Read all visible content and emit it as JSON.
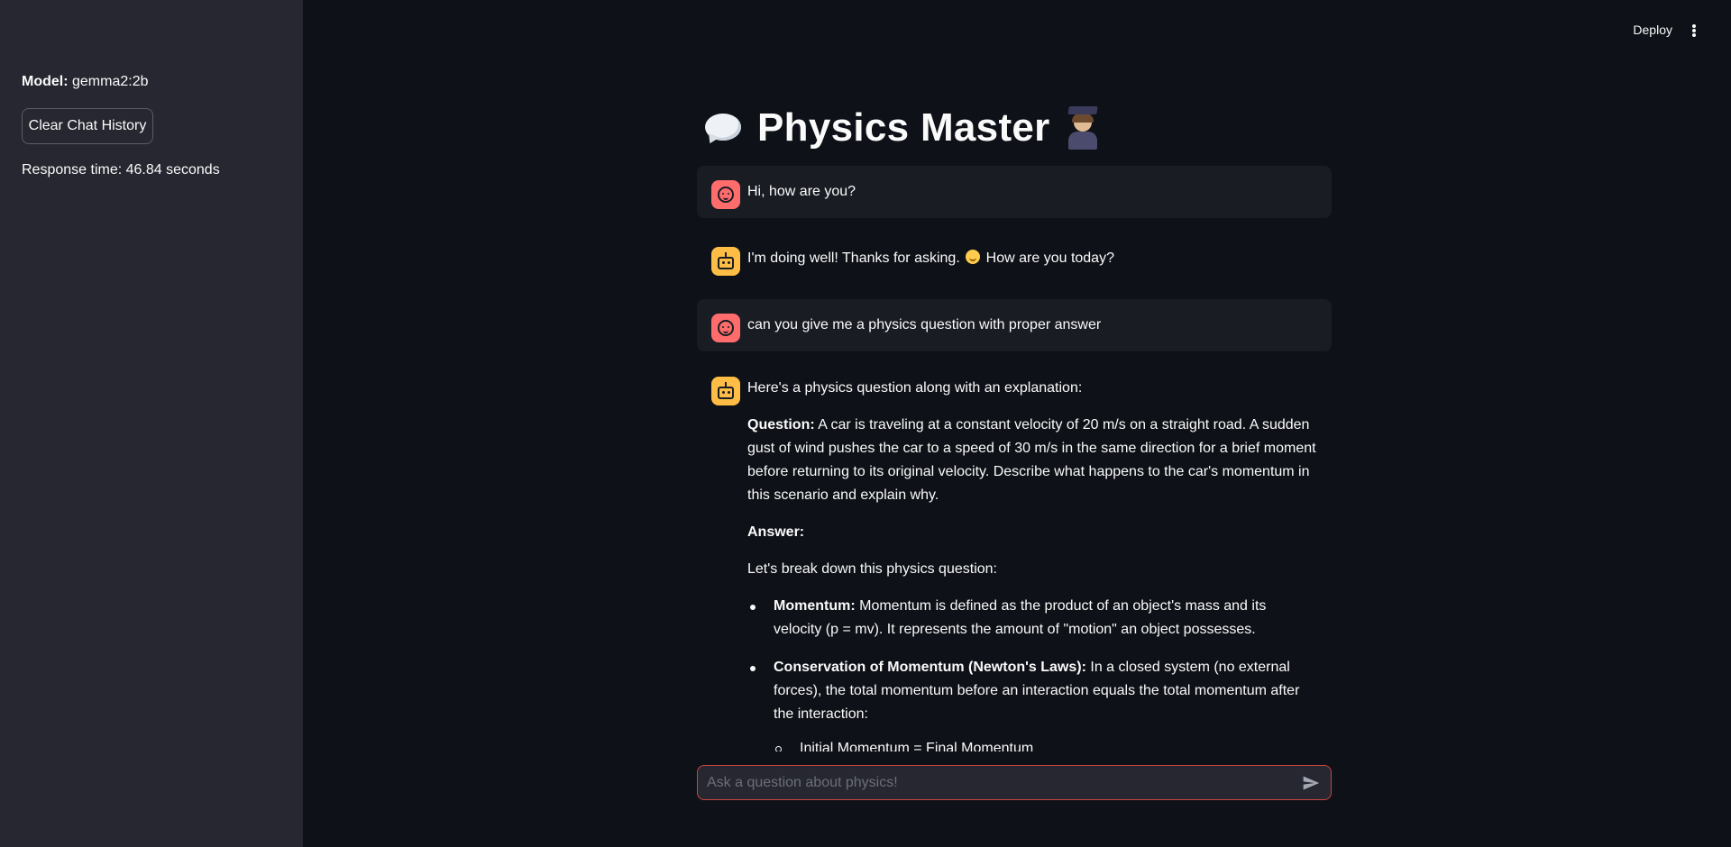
{
  "sidebar": {
    "model_label": "Model:",
    "model_value": "gemma2:2b",
    "clear_button": "Clear Chat History",
    "response_time": "Response time: 46.84 seconds"
  },
  "header": {
    "deploy": "Deploy"
  },
  "title": {
    "text": "Physics Master",
    "left_icon": "speech-bubble-icon",
    "right_icon": "student-icon"
  },
  "messages": {
    "m1": {
      "role": "user",
      "text": "Hi, how are you?"
    },
    "m2": {
      "role": "assistant",
      "text_before": "I'm doing well! Thanks for asking.",
      "emoji": "smiling-face-icon",
      "text_after": "How are you today?"
    },
    "m3": {
      "role": "user",
      "text": "can you give me a physics question with proper answer"
    },
    "m4": {
      "role": "assistant",
      "intro": "Here's a physics question along with an explanation:",
      "question_label": "Question:",
      "question_text": "A car is traveling at a constant velocity of 20 m/s on a straight road. A sudden gust of wind pushes the car to a speed of 30 m/s in the same direction for a brief moment before returning to its original velocity. Describe what happens to the car's momentum in this scenario and explain why.",
      "answer_label": "Answer:",
      "breakdown": "Let's break down this physics question:",
      "bullets": [
        {
          "label": "Momentum:",
          "text": "Momentum is defined as the product of an object's mass and its velocity (p = mv). It represents the amount of \"motion\" an object possesses."
        },
        {
          "label": "Conservation of Momentum (Newton's Laws):",
          "text": "In a closed system (no external forces), the total momentum before an interaction equals the total momentum after the interaction:"
        }
      ],
      "sub_bullet": "Initial Momentum = Final Momentum"
    }
  },
  "input": {
    "placeholder": "Ask a question about physics!",
    "value": ""
  },
  "colors": {
    "background": "#0e1117",
    "sidebar": "#262730",
    "user_avatar": "#ff6c6c",
    "bot_avatar": "#ffbd45",
    "input_border": "#c8463f"
  }
}
